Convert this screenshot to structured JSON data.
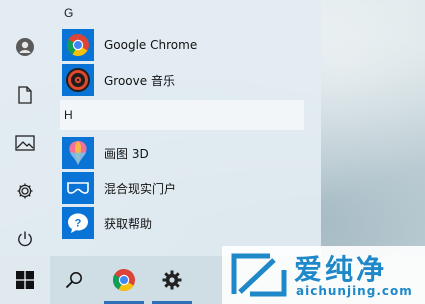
{
  "start_menu": {
    "groups": [
      {
        "letter": "G",
        "apps": [
          {
            "label": "Google Chrome",
            "icon": "chrome-icon"
          },
          {
            "label": "Groove 音乐",
            "icon": "groove-music-icon"
          }
        ]
      },
      {
        "letter": "H",
        "apps": [
          {
            "label": "画图 3D",
            "icon": "paint-3d-icon"
          },
          {
            "label": "混合现实门户",
            "icon": "mixed-reality-portal-icon"
          },
          {
            "label": "获取帮助",
            "icon": "get-help-icon"
          }
        ]
      }
    ],
    "rail": [
      "user-avatar-icon",
      "documents-icon",
      "pictures-icon",
      "settings-icon",
      "power-icon"
    ]
  },
  "taskbar": {
    "items": [
      "windows-start-icon",
      "search-icon",
      "chrome-icon",
      "settings-icon"
    ]
  },
  "watermark": {
    "title": "爱纯净",
    "url": "aichunjing.com"
  },
  "colors": {
    "tile_blue": "#0a74d6",
    "menu_bg": "#e2ecf2",
    "taskbar_bg": "#cddce4",
    "watermark_blue": "#1e88c8",
    "active_underline": "#2f6fb8"
  }
}
